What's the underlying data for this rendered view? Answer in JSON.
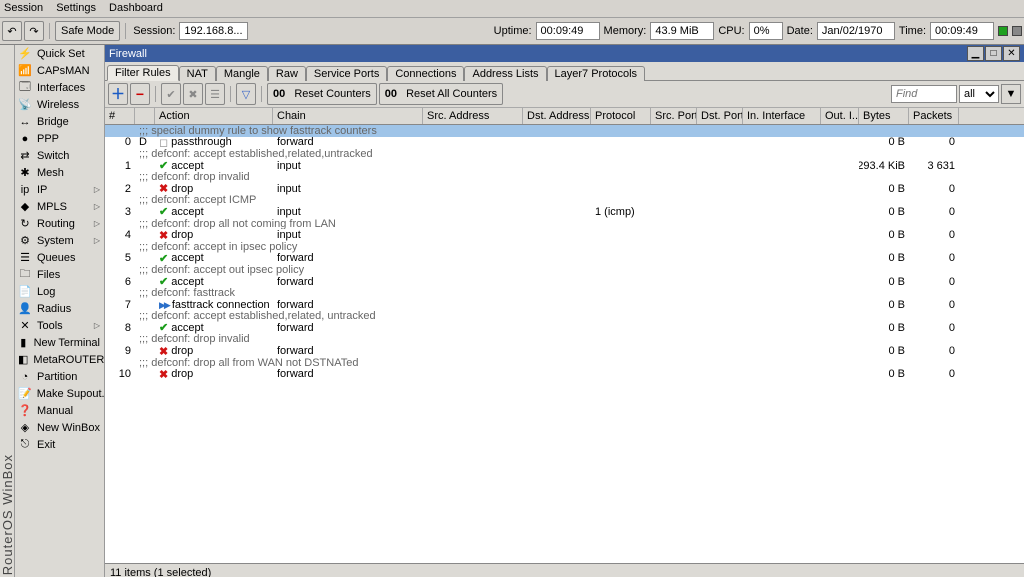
{
  "menubar": [
    "Session",
    "Settings",
    "Dashboard"
  ],
  "toolbar": {
    "safe_mode": "Safe Mode",
    "session_label": "Session:",
    "session_value": "192.168.8...",
    "uptime_label": "Uptime:",
    "uptime_value": "00:09:49",
    "memory_label": "Memory:",
    "memory_value": "43.9 MiB",
    "cpu_label": "CPU:",
    "cpu_value": "0%",
    "date_label": "Date:",
    "date_value": "Jan/02/1970",
    "time_label": "Time:",
    "time_value": "00:09:49"
  },
  "app_title": "RouterOS WinBox",
  "sidebar": [
    {
      "icon": "⚡",
      "label": "Quick Set"
    },
    {
      "icon": "📶",
      "label": "CAPsMAN"
    },
    {
      "icon": "🗔",
      "label": "Interfaces"
    },
    {
      "icon": "📡",
      "label": "Wireless"
    },
    {
      "icon": "↔",
      "label": "Bridge"
    },
    {
      "icon": "●",
      "label": "PPP"
    },
    {
      "icon": "⇄",
      "label": "Switch"
    },
    {
      "icon": "✱",
      "label": "Mesh"
    },
    {
      "icon": "ip",
      "label": "IP",
      "sub": true
    },
    {
      "icon": "◆",
      "label": "MPLS",
      "sub": true
    },
    {
      "icon": "↻",
      "label": "Routing",
      "sub": true
    },
    {
      "icon": "⚙",
      "label": "System",
      "sub": true
    },
    {
      "icon": "☰",
      "label": "Queues"
    },
    {
      "icon": "🗀",
      "label": "Files"
    },
    {
      "icon": "📄",
      "label": "Log"
    },
    {
      "icon": "👤",
      "label": "Radius"
    },
    {
      "icon": "✕",
      "label": "Tools",
      "sub": true
    },
    {
      "icon": "▮",
      "label": "New Terminal"
    },
    {
      "icon": "◧",
      "label": "MetaROUTER"
    },
    {
      "icon": "◔",
      "label": "Partition"
    },
    {
      "icon": "📝",
      "label": "Make Supout.rif"
    },
    {
      "icon": "❓",
      "label": "Manual"
    },
    {
      "icon": "◈",
      "label": "New WinBox"
    },
    {
      "icon": "⎋",
      "label": "Exit"
    }
  ],
  "window": {
    "title": "Firewall",
    "tabs": [
      "Filter Rules",
      "NAT",
      "Mangle",
      "Raw",
      "Service Ports",
      "Connections",
      "Address Lists",
      "Layer7 Protocols"
    ],
    "active_tab": 0,
    "reset_counters": "Reset Counters",
    "reset_all": "Reset All Counters",
    "find_placeholder": "Find",
    "filter_all": "all",
    "columns": [
      "#",
      "",
      "Action",
      "Chain",
      "Src. Address",
      "Dst. Address",
      "Protocol",
      "Src. Port",
      "Dst. Port",
      "In. Interface",
      "Out. I...",
      "Bytes",
      "Packets"
    ],
    "rows": [
      {
        "comment": ";;; special dummy rule to show fasttrack counters",
        "selected": true
      },
      {
        "num": "0",
        "flag": "D",
        "action": "passthrough",
        "chain": "forward",
        "bytes": "0 B",
        "packets": "0"
      },
      {
        "comment": ";;; defconf: accept established,related,untracked"
      },
      {
        "num": "1",
        "action": "accept",
        "chain": "input",
        "bytes": "293.4 KiB",
        "packets": "3 631"
      },
      {
        "comment": ";;; defconf: drop invalid"
      },
      {
        "num": "2",
        "action": "drop",
        "chain": "input",
        "bytes": "0 B",
        "packets": "0"
      },
      {
        "comment": ";;; defconf: accept ICMP"
      },
      {
        "num": "3",
        "action": "accept",
        "chain": "input",
        "protocol": "1 (icmp)",
        "bytes": "0 B",
        "packets": "0"
      },
      {
        "comment": ";;; defconf: drop all not coming from LAN"
      },
      {
        "num": "4",
        "action": "drop",
        "chain": "input",
        "bytes": "0 B",
        "packets": "0"
      },
      {
        "comment": ";;; defconf: accept in ipsec policy"
      },
      {
        "num": "5",
        "action": "accept",
        "chain": "forward",
        "bytes": "0 B",
        "packets": "0"
      },
      {
        "comment": ";;; defconf: accept out ipsec policy"
      },
      {
        "num": "6",
        "action": "accept",
        "chain": "forward",
        "bytes": "0 B",
        "packets": "0"
      },
      {
        "comment": ";;; defconf: fasttrack"
      },
      {
        "num": "7",
        "action": "fasttrack connection",
        "chain": "forward",
        "bytes": "0 B",
        "packets": "0"
      },
      {
        "comment": ";;; defconf: accept established,related, untracked"
      },
      {
        "num": "8",
        "action": "accept",
        "chain": "forward",
        "bytes": "0 B",
        "packets": "0"
      },
      {
        "comment": ";;; defconf: drop invalid"
      },
      {
        "num": "9",
        "action": "drop",
        "chain": "forward",
        "bytes": "0 B",
        "packets": "0"
      },
      {
        "comment": ";;; defconf:  drop all from WAN not DSTNATed"
      },
      {
        "num": "10",
        "action": "drop",
        "chain": "forward",
        "bytes": "0 B",
        "packets": "0"
      }
    ],
    "status": "11 items (1 selected)"
  }
}
